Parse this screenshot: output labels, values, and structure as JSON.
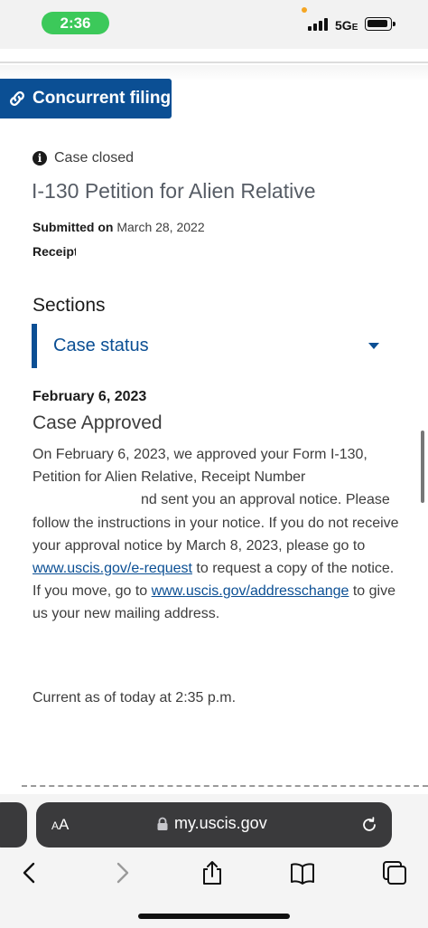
{
  "status_bar": {
    "time": "2:36",
    "network": "5G",
    "network_suffix": "E"
  },
  "concurrent_filing": {
    "label": "Concurrent filing"
  },
  "case": {
    "status_label": "Case closed",
    "title": "I-130 Petition for Alien Relative",
    "submitted_label": "Submitted on",
    "submitted_date": "March 28, 2022",
    "receipt_label": "Receipt"
  },
  "sections": {
    "heading": "Sections",
    "selected": "Case status"
  },
  "status_update": {
    "date": "February 6, 2023",
    "heading": "Case Approved",
    "body_1": "On February 6, 2023, we approved your Form I-130, Petition for Alien Relative, Receipt Number ",
    "body_2": "nd sent you an approval notice. Please follow the instructions in your notice. If you do not receive your approval notice by March 8, 2023, please go to ",
    "link_1": "www.uscis.gov/e-request",
    "body_3": " to request a copy of the notice. If you move, go to ",
    "link_2": "www.uscis.gov/addresschange",
    "body_4": " to give us your new mailing address.",
    "current_as_of": "Current as of today at 2:35 p.m."
  },
  "browser": {
    "aa_big": "A",
    "aa_small": "A",
    "url": "my.uscis.gov",
    "icons": [
      "back-icon",
      "forward-icon",
      "share-icon",
      "bookmarks-icon",
      "tabs-icon",
      "lock-icon",
      "reload-icon",
      "link-icon",
      "info-icon"
    ]
  },
  "colors": {
    "brand_blue": "#0b4f94",
    "time_pill_green": "#3cc95a",
    "text_dark": "#1b1b1b"
  }
}
